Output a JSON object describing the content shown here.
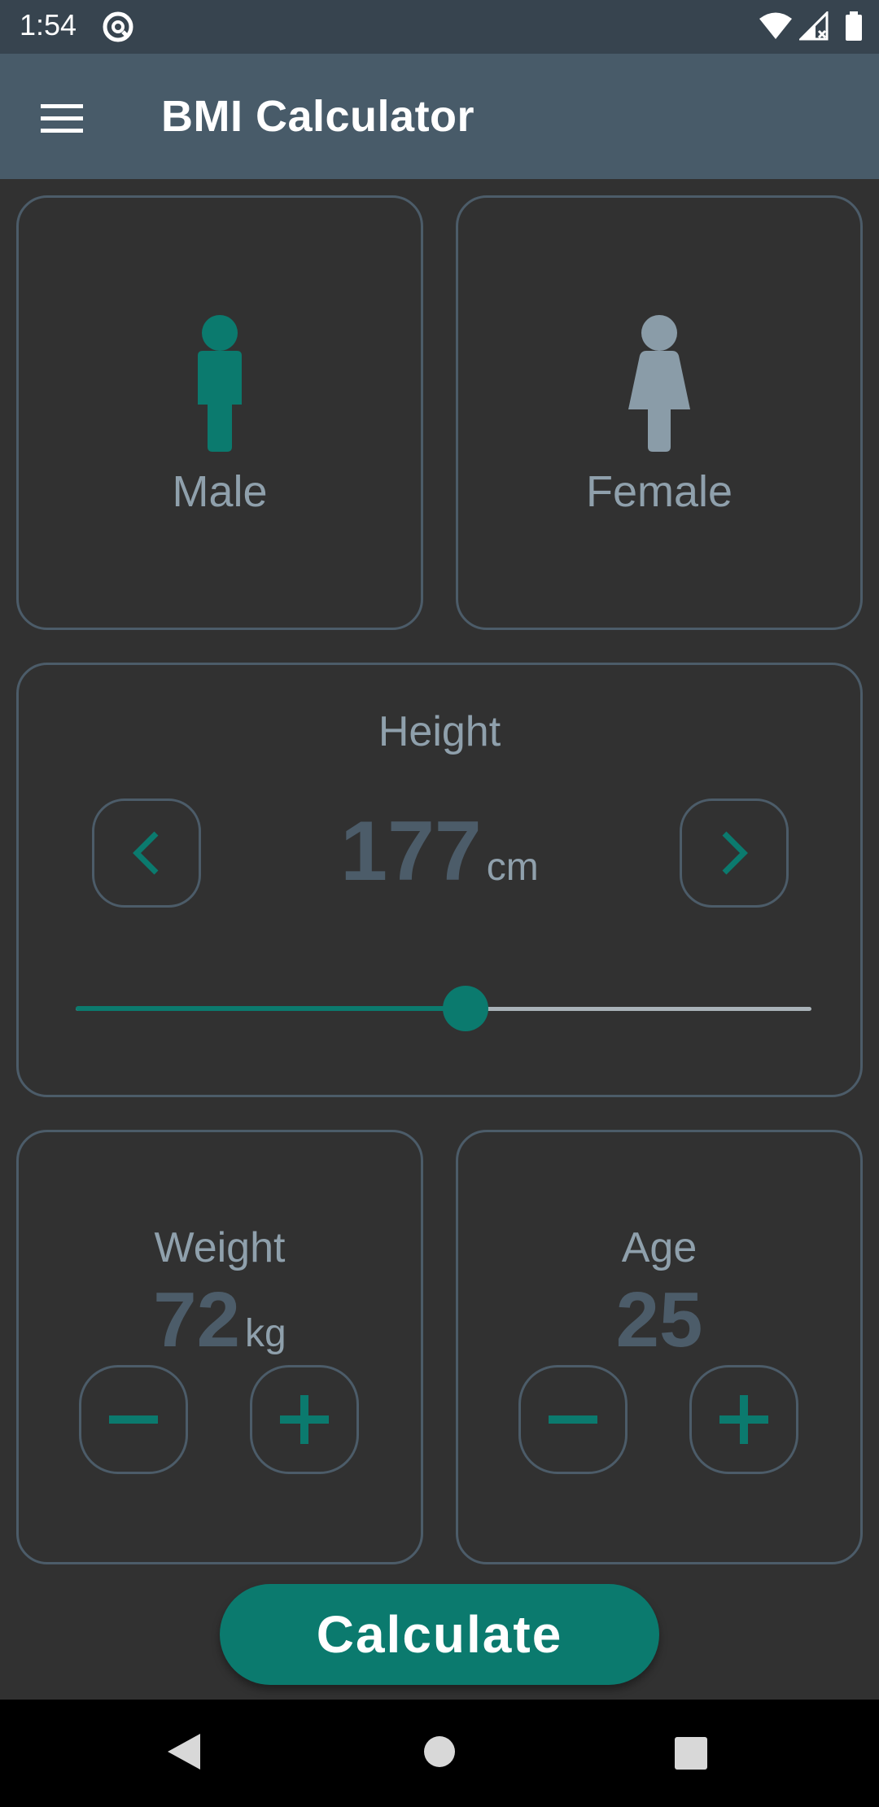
{
  "status_bar": {
    "time": "1:54"
  },
  "app_bar": {
    "title": "BMI Calculator"
  },
  "gender": {
    "male_label": "Male",
    "female_label": "Female",
    "selected": "Male"
  },
  "height": {
    "label": "Height",
    "value": "177",
    "unit": "cm",
    "slider_fraction": 0.53
  },
  "weight": {
    "label": "Weight",
    "value": "72",
    "unit": "kg"
  },
  "age": {
    "label": "Age",
    "value": "25"
  },
  "calculate_label": "Calculate",
  "colors": {
    "accent": "#0b7a6e",
    "background": "#313131",
    "app_bar": "#485b69",
    "status_bar": "#37444f",
    "border": "#4c5c69",
    "muted_text": "#8fa0ac"
  }
}
